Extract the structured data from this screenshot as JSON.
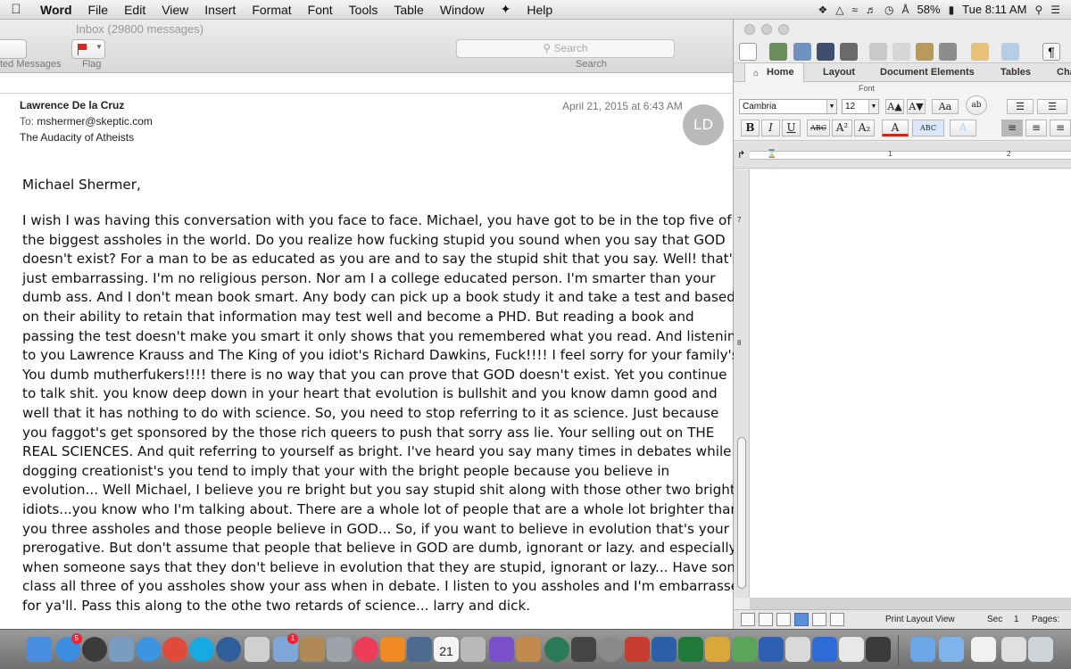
{
  "menubar": {
    "app_name": "Word",
    "items": [
      "File",
      "Edit",
      "View",
      "Insert",
      "Format",
      "Font",
      "Tools",
      "Table",
      "Window",
      "Help"
    ],
    "battery": "58%",
    "clock": "Tue 8:11 AM"
  },
  "mail": {
    "window_title": "Inbox (29800 messages)",
    "toolbar": {
      "flag_label": "Flag",
      "left_label": "ted Messages",
      "search_placeholder": "Search",
      "search_label": "Search"
    },
    "message": {
      "from": "Lawrence De la Cruz",
      "to_prefix": "To:",
      "to": "mshermer@skeptic.com",
      "subject": "The Audacity of Atheists",
      "date": "April 21, 2015 at 6:43 AM",
      "avatar_initials": "LD",
      "salutation": "Michael Shermer,",
      "body_lines": [
        "I wish I was having this conversation with you face to face.  Michael, you have got to be in the top five of",
        "the biggest assholes in the world.  Do you realize how fucking stupid you sound when you say that GOD",
        "doesn't exist?  For a man to be as educated as you are and to say the stupid shit that you say.  Well! that's",
        "just embarrassing.  I'm no religious person.  Nor am I a college educated person. I'm smarter than your",
        "dumb ass.  And I don't mean book smart. Any body can pick up a book study it and take a test and based",
        "on their ability to retain that information may test well and become a PHD.  But reading a book and",
        "passing the test doesn't make you smart it only shows that you remembered what you read.  And listening",
        "to you Lawrence Krauss and The King of you idiot's Richard Dawkins,  Fuck!!!! I feel sorry for your family's.",
        "You dumb mutherfukers!!!!  there is no way that you can prove that GOD doesn't exist.  Yet you continue",
        "to talk shit.  you know deep down in your heart that evolution is bullshit and you know damn good and",
        "well that it has nothing to do with science.  So, you need to stop referring to it as science.  Just because",
        "you faggot's get sponsored by the those rich queers to push that sorry ass lie.  Your selling out on THE",
        "REAL SCIENCES.  And quit referring to yourself as bright.  I've heard you say many times in debates while",
        "dogging creationist's you tend to imply that your with the bright people because you believe in",
        "evolution...  Well Michael, I believe you re bright but you say stupid shit along with those other two bright",
        "idiots...you know who I'm talking about.  There are a whole lot of people that are a whole lot brighter than",
        "you three assholes and those people believe in GOD...  So, if you want to believe in evolution that's your",
        "prerogative.  But don't assume that people that believe in GOD are dumb, ignorant or lazy.  and especially",
        "when someone says that they don't believe in evolution that they are stupid, ignorant or lazy...  Have some",
        "class all three of you assholes show your ass when in debate.  I listen to you assholes and I'm embarrassed",
        "for ya'll. Pass this along to the othe two retards of science...  larry and dick."
      ]
    }
  },
  "word": {
    "ribbon_tabs": [
      "Home",
      "Layout",
      "Document Elements",
      "Tables",
      "Cha"
    ],
    "font_group_label": "Font",
    "font_name": "Cambria",
    "font_size": "12",
    "format_buttons": [
      "B",
      "I",
      "U",
      "ABC",
      "A²",
      "A₂"
    ],
    "ruler_marks": [
      "1",
      "2"
    ],
    "vruler_marks": [
      "7",
      "8"
    ],
    "status": {
      "view": "Print Layout View",
      "section_label": "Sec",
      "section": "1",
      "pages_label": "Pages:"
    }
  },
  "dock": {
    "calendar_day": "21",
    "mail_badge": "1",
    "appstore_badge": "5"
  }
}
